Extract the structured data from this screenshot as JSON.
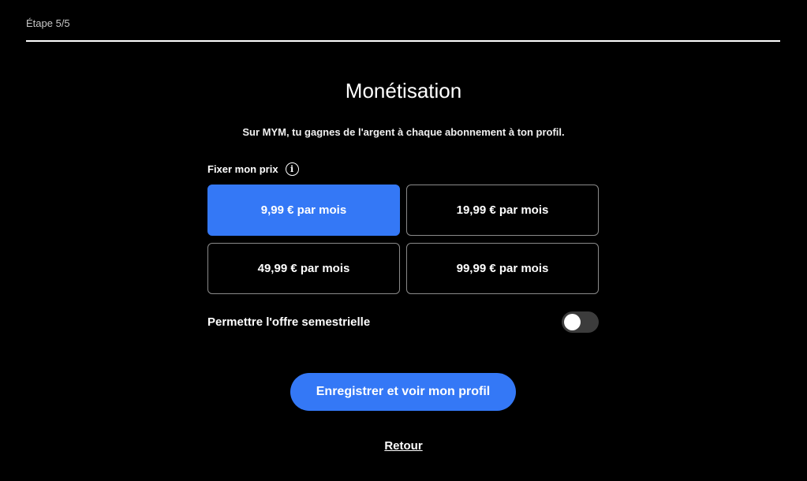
{
  "header": {
    "step_label": "Étape 5/5",
    "progress_fraction": 1.0
  },
  "main": {
    "title": "Monétisation",
    "subtitle": "Sur MYM, tu gagnes de l'argent à chaque abonnement à ton profil.",
    "price_section_label": "Fixer mon prix",
    "info_icon": "info-icon",
    "price_options": [
      {
        "label": "9,99 € par mois",
        "selected": true
      },
      {
        "label": "19,99 € par mois",
        "selected": false
      },
      {
        "label": "49,99 € par mois",
        "selected": false
      },
      {
        "label": "99,99 € par mois",
        "selected": false
      }
    ],
    "semester_toggle_label": "Permettre l'offre semestrielle",
    "semester_toggle_on": false,
    "save_button_label": "Enregistrer et voir mon profil",
    "back_link_label": "Retour"
  },
  "colors": {
    "background": "#000000",
    "accent": "#3478f6",
    "text": "#ffffff"
  }
}
